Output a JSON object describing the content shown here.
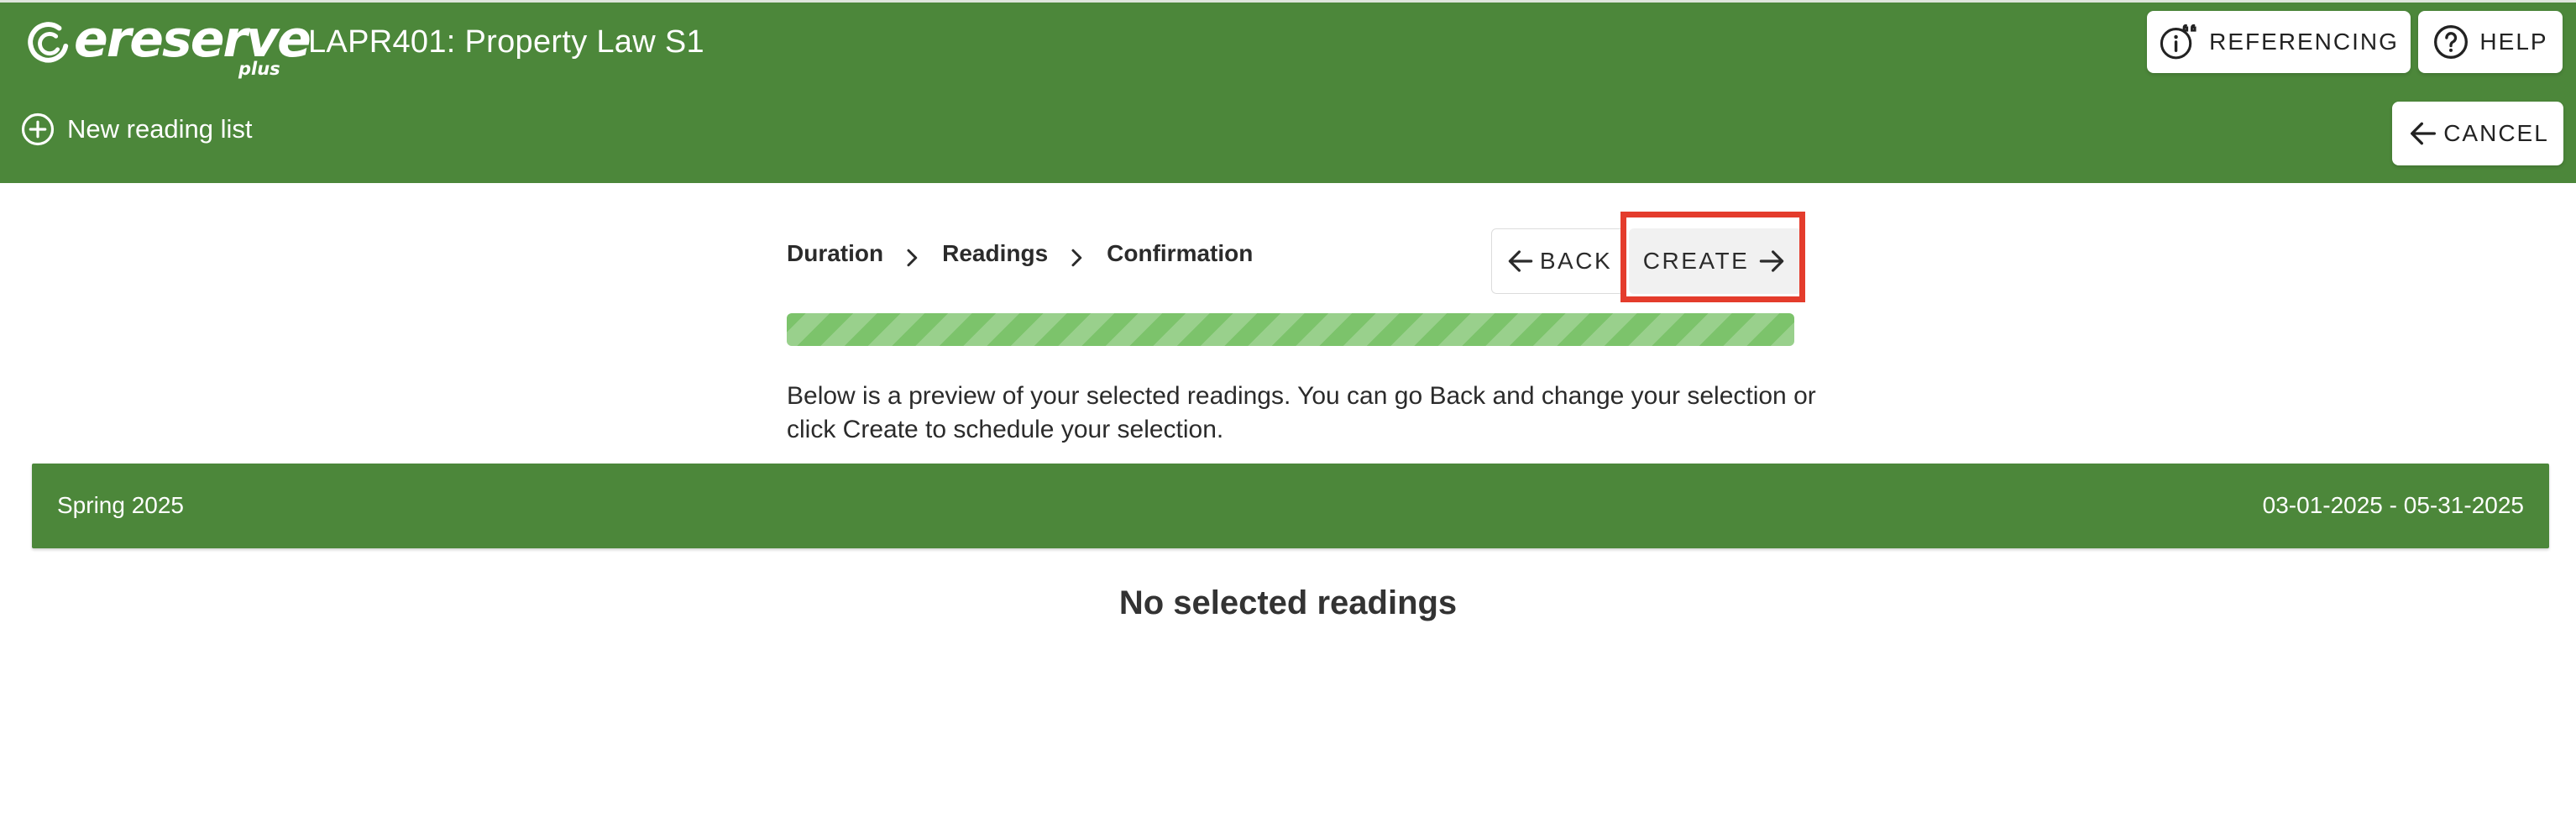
{
  "header": {
    "logo": {
      "word": "ereserve",
      "sub": "plus"
    },
    "course_title": "LAPR401: Property Law S1",
    "new_list_label": "New reading list",
    "referencing_label": "REFERENCING",
    "help_label": "HELP",
    "cancel_label": "CANCEL"
  },
  "steps": [
    {
      "label": "Duration"
    },
    {
      "label": "Readings"
    },
    {
      "label": "Confirmation"
    }
  ],
  "actions": {
    "back_label": "BACK",
    "create_label": "CREATE"
  },
  "progress": {
    "value": 1.0
  },
  "description": "Below is a preview of your selected readings. You can go Back and change your selection or click Create to schedule your selection.",
  "term": {
    "name": "Spring 2025",
    "dates": "03-01-2025 - 05-31-2025"
  },
  "empty_message": "No selected readings",
  "icons": {
    "logo": "ereserve-swirl-icon",
    "new_list": "plus-circle-icon",
    "referencing": "info-quote-icon",
    "help": "question-circle-icon",
    "cancel": "arrow-left-icon",
    "step_separator": "chevron-right-icon",
    "back": "arrow-left-icon",
    "create": "arrow-right-icon"
  },
  "colors": {
    "brand_green": "#4c873a",
    "progress_green": "#7cc36b",
    "highlight_red": "#e43c2c"
  }
}
